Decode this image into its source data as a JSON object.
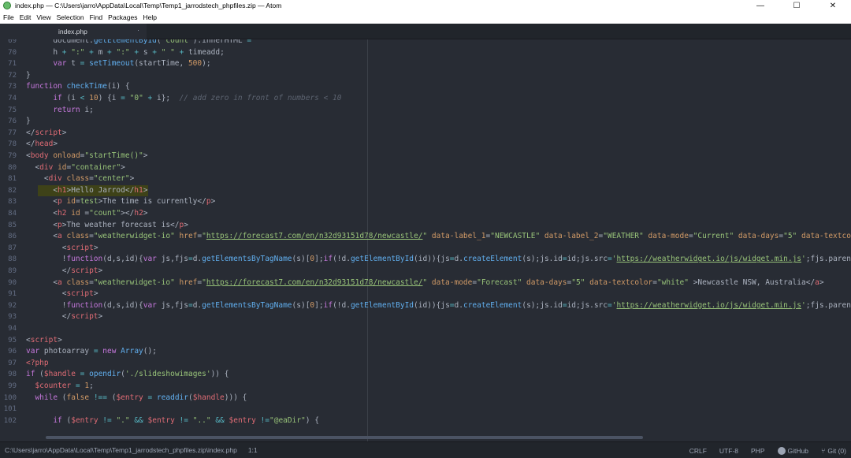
{
  "window": {
    "title": "index.php — C:\\Users\\jarro\\AppData\\Local\\Temp\\Temp1_jarrodstech_phpfiles.zip — Atom",
    "minimize": "—",
    "maximize": "☐",
    "close": "✕"
  },
  "menu": [
    "File",
    "Edit",
    "View",
    "Selection",
    "Find",
    "Packages",
    "Help"
  ],
  "tab": {
    "label": "index.php",
    "close": "·"
  },
  "lines": [
    {
      "n": "69",
      "segs": [
        [
          "p",
          "      "
        ],
        [
          "p",
          "document"
        ],
        [
          "p",
          "."
        ],
        [
          "f",
          "getElementById"
        ],
        [
          "p",
          "("
        ],
        [
          "s",
          "\"count\""
        ],
        [
          "p",
          ")."
        ],
        [
          "p",
          "innerHTML"
        ],
        [
          "o",
          " ="
        ]
      ]
    },
    {
      "n": "70",
      "segs": [
        [
          "p",
          "      h "
        ],
        [
          "o",
          "+"
        ],
        [
          "s",
          " \":\" "
        ],
        [
          "o",
          "+"
        ],
        [
          "p",
          " m "
        ],
        [
          "o",
          "+"
        ],
        [
          "s",
          " \":\" "
        ],
        [
          "o",
          "+"
        ],
        [
          "p",
          " s "
        ],
        [
          "o",
          "+"
        ],
        [
          "s",
          " \" \" "
        ],
        [
          "o",
          "+"
        ],
        [
          "p",
          " timeadd;"
        ]
      ]
    },
    {
      "n": "71",
      "segs": [
        [
          "k",
          "      var"
        ],
        [
          "p",
          " t "
        ],
        [
          "o",
          "="
        ],
        [
          "f",
          " setTimeout"
        ],
        [
          "p",
          "(startTime, "
        ],
        [
          "n",
          "500"
        ],
        [
          "p",
          ");"
        ]
      ]
    },
    {
      "n": "72",
      "segs": [
        [
          "p",
          "}"
        ]
      ]
    },
    {
      "n": "73",
      "segs": [
        [
          "k",
          "function"
        ],
        [
          "f",
          " checkTime"
        ],
        [
          "p",
          "(i) {"
        ]
      ]
    },
    {
      "n": "74",
      "segs": [
        [
          "k",
          "      if"
        ],
        [
          "p",
          " (i "
        ],
        [
          "o",
          "<"
        ],
        [
          "n",
          " 10"
        ],
        [
          "p",
          ") {i "
        ],
        [
          "o",
          "="
        ],
        [
          "s",
          " \"0\" "
        ],
        [
          "o",
          "+"
        ],
        [
          "p",
          " i};  "
        ],
        [
          "c",
          "// add zero in front of numbers < 10"
        ]
      ]
    },
    {
      "n": "75",
      "segs": [
        [
          "k",
          "      return"
        ],
        [
          "p",
          " i;"
        ]
      ]
    },
    {
      "n": "76",
      "segs": [
        [
          "p",
          "}"
        ]
      ]
    },
    {
      "n": "77",
      "segs": [
        [
          "p",
          "</"
        ],
        [
          "t",
          "script"
        ],
        [
          "p",
          ">"
        ]
      ]
    },
    {
      "n": "78",
      "segs": [
        [
          "p",
          "</"
        ],
        [
          "t",
          "head"
        ],
        [
          "p",
          ">"
        ]
      ]
    },
    {
      "n": "79",
      "segs": [
        [
          "p",
          "<"
        ],
        [
          "t",
          "body"
        ],
        [
          "a",
          " onload"
        ],
        [
          "p",
          "="
        ],
        [
          "s",
          "\"startTime()\""
        ],
        [
          "p",
          ">"
        ]
      ]
    },
    {
      "n": "80",
      "segs": [
        [
          "p",
          "  <"
        ],
        [
          "t",
          "div"
        ],
        [
          "a",
          " id"
        ],
        [
          "p",
          "="
        ],
        [
          "s",
          "\"container\""
        ],
        [
          "p",
          ">"
        ]
      ]
    },
    {
      "n": "81",
      "segs": [
        [
          "p",
          "    <"
        ],
        [
          "t",
          "div"
        ],
        [
          "a",
          " class"
        ],
        [
          "p",
          "="
        ],
        [
          "s",
          "\"center\""
        ],
        [
          "p",
          ">"
        ]
      ]
    },
    {
      "n": "82",
      "segs": [
        [
          "p",
          "      <"
        ],
        [
          "t",
          "h1"
        ],
        [
          "p",
          ">Hello Jarrod</"
        ],
        [
          "t",
          "h1"
        ],
        [
          "p",
          ">"
        ]
      ]
    },
    {
      "n": "83",
      "segs": [
        [
          "p",
          "      <"
        ],
        [
          "t",
          "p"
        ],
        [
          "a",
          " id"
        ],
        [
          "p",
          "="
        ],
        [
          "s",
          "test"
        ],
        [
          "p",
          ">The time is currently</"
        ],
        [
          "t",
          "p"
        ],
        [
          "p",
          ">"
        ]
      ]
    },
    {
      "n": "84",
      "segs": [
        [
          "p",
          "      <"
        ],
        [
          "t",
          "h2"
        ],
        [
          "a",
          " id"
        ],
        [
          "p",
          " ="
        ],
        [
          "s",
          "\"count\""
        ],
        [
          "p",
          "></"
        ],
        [
          "t",
          "h2"
        ],
        [
          "p",
          ">"
        ]
      ]
    },
    {
      "n": "85",
      "segs": [
        [
          "p",
          "      <"
        ],
        [
          "t",
          "p"
        ],
        [
          "p",
          ">The weather forecast is</"
        ],
        [
          "t",
          "p"
        ],
        [
          "p",
          ">"
        ]
      ]
    },
    {
      "n": "86",
      "segs": [
        [
          "p",
          "      <"
        ],
        [
          "t",
          "a"
        ],
        [
          "a",
          " class"
        ],
        [
          "p",
          "="
        ],
        [
          "s",
          "\"weatherwidget-io\""
        ],
        [
          "a",
          " href"
        ],
        [
          "p",
          "="
        ],
        [
          "s",
          "\""
        ],
        [
          "u",
          "https://forecast7.com/en/n32d93151d78/newcastle/"
        ],
        [
          "s",
          "\""
        ],
        [
          "a",
          " data-label_1"
        ],
        [
          "p",
          "="
        ],
        [
          "s",
          "\"NEWCASTLE\""
        ],
        [
          "a",
          " data-label_2"
        ],
        [
          "p",
          "="
        ],
        [
          "s",
          "\"WEATHER\""
        ],
        [
          "a",
          " data-mode"
        ],
        [
          "p",
          "="
        ],
        [
          "s",
          "\"Current\""
        ],
        [
          "a",
          " data-days"
        ],
        [
          "p",
          "="
        ],
        [
          "s",
          "\"5\""
        ],
        [
          "a",
          " data-textcolor"
        ],
        [
          "p",
          "="
        ],
        [
          "s",
          "\"whit"
        ]
      ]
    },
    {
      "n": "87",
      "segs": [
        [
          "p",
          "        <"
        ],
        [
          "t",
          "script"
        ],
        [
          "p",
          ">"
        ]
      ]
    },
    {
      "n": "88",
      "segs": [
        [
          "p",
          "        !"
        ],
        [
          "k",
          "function"
        ],
        [
          "p",
          "(d,s,id){"
        ],
        [
          "k",
          "var"
        ],
        [
          "p",
          " js,fjs"
        ],
        [
          "o",
          "="
        ],
        [
          "p",
          "d."
        ],
        [
          "f",
          "getElementsByTagName"
        ],
        [
          "p",
          "(s)["
        ],
        [
          "n",
          "0"
        ],
        [
          "p",
          "];"
        ],
        [
          "k",
          "if"
        ],
        [
          "p",
          "(!d."
        ],
        [
          "f",
          "getElementById"
        ],
        [
          "p",
          "(id)){js"
        ],
        [
          "o",
          "="
        ],
        [
          "p",
          "d."
        ],
        [
          "f",
          "createElement"
        ],
        [
          "p",
          "(s);js.id"
        ],
        [
          "o",
          "="
        ],
        [
          "p",
          "id;js.src"
        ],
        [
          "o",
          "="
        ],
        [
          "s",
          "'"
        ],
        [
          "u",
          "https://weatherwidget.io/js/widget.min.js"
        ],
        [
          "s",
          "'"
        ],
        [
          "p",
          ";fjs.parentNode.ins"
        ]
      ]
    },
    {
      "n": "89",
      "segs": [
        [
          "p",
          "        </"
        ],
        [
          "t",
          "script"
        ],
        [
          "p",
          ">"
        ]
      ]
    },
    {
      "n": "90",
      "segs": [
        [
          "p",
          "      <"
        ],
        [
          "t",
          "a"
        ],
        [
          "a",
          " class"
        ],
        [
          "p",
          "="
        ],
        [
          "s",
          "\"weatherwidget-io\""
        ],
        [
          "a",
          " href"
        ],
        [
          "p",
          "="
        ],
        [
          "s",
          "\""
        ],
        [
          "u",
          "https://forecast7.com/en/n32d93151d78/newcastle/"
        ],
        [
          "s",
          "\""
        ],
        [
          "a",
          " data-mode"
        ],
        [
          "p",
          "="
        ],
        [
          "s",
          "\"Forecast\""
        ],
        [
          "a",
          " data-days"
        ],
        [
          "p",
          "="
        ],
        [
          "s",
          "\"5\""
        ],
        [
          "a",
          " data-textcolor"
        ],
        [
          "p",
          "="
        ],
        [
          "s",
          "\"white\""
        ],
        [
          "p",
          " >Newcastle NSW, Australia</"
        ],
        [
          "t",
          "a"
        ],
        [
          "p",
          ">"
        ]
      ]
    },
    {
      "n": "91",
      "segs": [
        [
          "p",
          "        <"
        ],
        [
          "t",
          "script"
        ],
        [
          "p",
          ">"
        ]
      ]
    },
    {
      "n": "92",
      "segs": [
        [
          "p",
          "        !"
        ],
        [
          "k",
          "function"
        ],
        [
          "p",
          "(d,s,id){"
        ],
        [
          "k",
          "var"
        ],
        [
          "p",
          " js,fjs"
        ],
        [
          "o",
          "="
        ],
        [
          "p",
          "d."
        ],
        [
          "f",
          "getElementsByTagName"
        ],
        [
          "p",
          "(s)["
        ],
        [
          "n",
          "0"
        ],
        [
          "p",
          "];"
        ],
        [
          "k",
          "if"
        ],
        [
          "p",
          "(!d."
        ],
        [
          "f",
          "getElementById"
        ],
        [
          "p",
          "(id)){js"
        ],
        [
          "o",
          "="
        ],
        [
          "p",
          "d."
        ],
        [
          "f",
          "createElement"
        ],
        [
          "p",
          "(s);js.id"
        ],
        [
          "o",
          "="
        ],
        [
          "p",
          "id;js.src"
        ],
        [
          "o",
          "="
        ],
        [
          "s",
          "'"
        ],
        [
          "u",
          "https://weatherwidget.io/js/widget.min.js"
        ],
        [
          "s",
          "'"
        ],
        [
          "p",
          ";fjs.parentNode.ins"
        ]
      ]
    },
    {
      "n": "93",
      "segs": [
        [
          "p",
          "        </"
        ],
        [
          "t",
          "script"
        ],
        [
          "p",
          ">"
        ]
      ]
    },
    {
      "n": "94",
      "segs": []
    },
    {
      "n": "95",
      "segs": [
        [
          "p",
          "<"
        ],
        [
          "t",
          "script"
        ],
        [
          "p",
          ">"
        ]
      ]
    },
    {
      "n": "96",
      "segs": [
        [
          "k",
          "var"
        ],
        [
          "p",
          " photoarray "
        ],
        [
          "o",
          "="
        ],
        [
          "k",
          " new"
        ],
        [
          "f",
          " Array"
        ],
        [
          "p",
          "();"
        ]
      ]
    },
    {
      "n": "97",
      "segs": [
        [
          "t",
          "<?php"
        ]
      ]
    },
    {
      "n": "98",
      "segs": [
        [
          "k",
          "if"
        ],
        [
          "p",
          " ("
        ],
        [
          "v",
          "$handle"
        ],
        [
          "o",
          " ="
        ],
        [
          "f",
          " opendir"
        ],
        [
          "p",
          "("
        ],
        [
          "s",
          "'./slideshowimages'"
        ],
        [
          "p",
          ")) {"
        ]
      ]
    },
    {
      "n": "99",
      "segs": [
        [
          "v",
          "  $counter"
        ],
        [
          "o",
          " ="
        ],
        [
          "n",
          " 1"
        ],
        [
          "p",
          ";"
        ]
      ]
    },
    {
      "n": "100",
      "segs": [
        [
          "k",
          "  while"
        ],
        [
          "p",
          " ("
        ],
        [
          "a",
          "false"
        ],
        [
          "o",
          " !=="
        ],
        [
          "p",
          " ("
        ],
        [
          "v",
          "$entry"
        ],
        [
          "o",
          " ="
        ],
        [
          "f",
          " readdir"
        ],
        [
          "p",
          "("
        ],
        [
          "v",
          "$handle"
        ],
        [
          "p",
          "))) {"
        ]
      ]
    },
    {
      "n": "101",
      "segs": []
    },
    {
      "n": "102",
      "segs": [
        [
          "k",
          "      if"
        ],
        [
          "p",
          " ("
        ],
        [
          "v",
          "$entry"
        ],
        [
          "o",
          " !="
        ],
        [
          "s",
          " \".\""
        ],
        [
          "o",
          " &&"
        ],
        [
          "v",
          " $entry"
        ],
        [
          "o",
          " !="
        ],
        [
          "s",
          " \"..\""
        ],
        [
          "o",
          " &&"
        ],
        [
          "v",
          " $entry"
        ],
        [
          "o",
          " !="
        ],
        [
          "s",
          "\"@eaDir\""
        ],
        [
          "p",
          ") {"
        ]
      ]
    }
  ],
  "status": {
    "path": "C:\\Users\\jarro\\AppData\\Local\\Temp\\Temp1_jarrodstech_phpfiles.zip\\index.php",
    "position": "1:1",
    "line_ending": "CRLF",
    "encoding": "UTF-8",
    "grammar": "PHP",
    "github": "GitHub",
    "git": "Git (0)"
  }
}
